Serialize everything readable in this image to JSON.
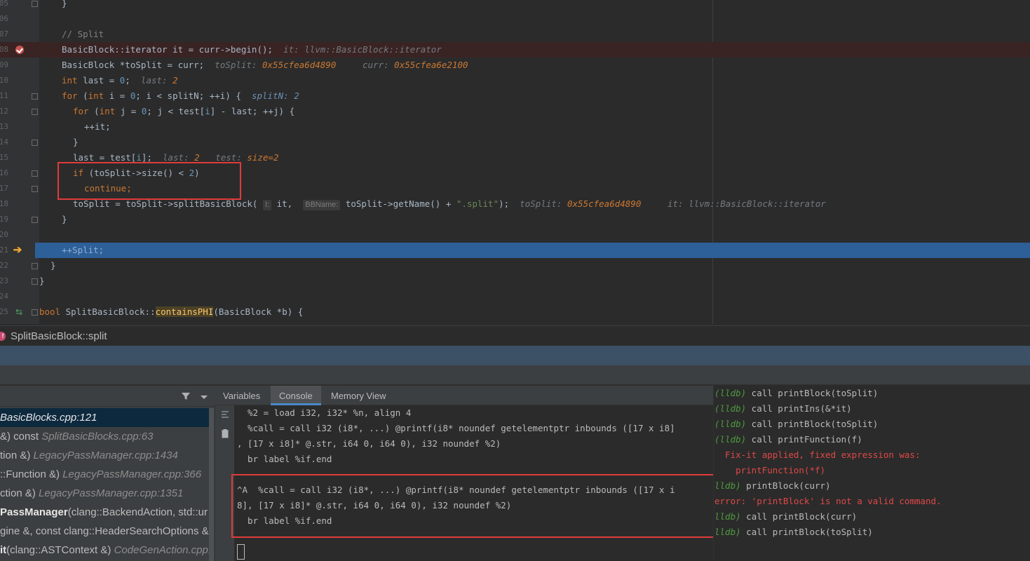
{
  "editor": {
    "lines": [
      {
        "num": "05",
        "code": "  }"
      },
      {
        "num": "06",
        "code": ""
      },
      {
        "num": "07",
        "code": "  // Split"
      },
      {
        "num": "08",
        "code": "  BasicBlock::iterator it = curr->begin();",
        "hint1_label": "it:",
        "hint1_value": "llvm::BasicBlock::iterator"
      },
      {
        "num": "09",
        "code": "  BasicBlock *toSplit = curr;",
        "hint1_label": "toSplit:",
        "hint1_value": "0x55cfea6d4890",
        "hint2_label": "curr:",
        "hint2_value": "0x55cfea6e2100"
      },
      {
        "num": "10",
        "code_kw": "int",
        "code_rest": " last = ",
        "code_num": "0",
        "code_end": ";",
        "hint1_label": "last:",
        "hint1_value": "2"
      },
      {
        "num": "11",
        "code": "  for (int i = 0; i < splitN; ++i) {",
        "hint1_label": "splitN:",
        "hint1_value": "2"
      },
      {
        "num": "12",
        "code": "    for (int j = 0; j < test[i] - last; ++j) {"
      },
      {
        "num": "13",
        "code": "      ++it;"
      },
      {
        "num": "14",
        "code": "    }"
      },
      {
        "num": "15",
        "code": "    last = test[i];",
        "hint1_label": "last:",
        "hint1_value": "2",
        "hint2_label": "test:",
        "hint2_value": "size=2"
      },
      {
        "num": "16",
        "code": "    if (toSplit->size() < 2)"
      },
      {
        "num": "17",
        "code": "      continue;"
      },
      {
        "num": "18",
        "code_a": "    toSplit = toSplit->splitBasicBlock(",
        "param1": "I:",
        "code_b": " it, ",
        "param2": "BBName:",
        "code_c": " toSplit->getName() + ",
        "code_str": "\".split\"",
        "code_d": ");",
        "hint1_label": "toSplit:",
        "hint1_value": "0x55cfea6d4890",
        "hint2_label": "it:",
        "hint2_value": "llvm::BasicBlock::iterator"
      },
      {
        "num": "19",
        "code": "  }"
      },
      {
        "num": "20",
        "code": ""
      },
      {
        "num": "21",
        "code": "  ++Split;"
      },
      {
        "num": "22",
        "code": "  }"
      },
      {
        "num": "23",
        "code": "}"
      },
      {
        "num": "24",
        "code": ""
      },
      {
        "num": "25",
        "code_kw": "bool",
        "code_rest": " SplitBasicBlock::",
        "code_fn": "containsPHI",
        "code_end": "(BasicBlock *b) {"
      }
    ]
  },
  "breadcrumb": {
    "icon_letter": "f",
    "function": "SplitBasicBlock::split"
  },
  "frames": {
    "items": [
      {
        "name": "",
        "file": "BasicBlocks.cpp:121",
        "selected": true
      },
      {
        "name": "&) const ",
        "file": "SplitBasicBlocks.cpp:63"
      },
      {
        "name": "tion &) ",
        "file": "LegacyPassManager.cpp:1434"
      },
      {
        "name": "::Function &) ",
        "file": "LegacyPassManager.cpp:366"
      },
      {
        "name": "ction &) ",
        "file": "LegacyPassManager.cpp:1351"
      },
      {
        "bold": "PassManager",
        "name": "(clang::BackendAction, std::ur",
        "file": ""
      },
      {
        "name": "gine &, const clang::HeaderSearchOptions &,",
        "file": ""
      },
      {
        "bold": "it",
        "name": "(clang::ASTContext &) ",
        "file": "CodeGenAction.cpp:"
      }
    ]
  },
  "tabs": {
    "variables": "Variables",
    "console": "Console",
    "memory": "Memory View"
  },
  "console": {
    "lines": [
      "  %2 = load i32, i32* %n, align 4",
      "  %call = call i32 (i8*, ...) @printf(i8* noundef getelementptr inbounds ([17 x i8]",
      ", [17 x i8]* @.str, i64 0, i64 0), i32 noundef %2)",
      "  br label %if.end",
      "^A  %call = call i32 (i8*, ...) @printf(i8* noundef getelementptr inbounds ([17 x i",
      "8], [17 x i8]* @.str, i64 0, i64 0), i32 noundef %2)",
      "  br label %if.end"
    ]
  },
  "lldb": {
    "lines": [
      {
        "prompt": "(lldb)",
        "text": " call printBlock(toSplit)"
      },
      {
        "prompt": "(lldb)",
        "text": " call printIns(&*it)"
      },
      {
        "prompt": "(lldb)",
        "text": " call printBlock(toSplit)"
      },
      {
        "prompt": "(lldb)",
        "text": " call printFunction(f)"
      },
      {
        "prompt": "",
        "text": "  Fix-it applied, fixed expression was:",
        "error": true
      },
      {
        "prompt": "",
        "text": "    printFunction(*f)",
        "error": true
      },
      {
        "prompt": "lldb)",
        "text": " printBlock(curr)"
      },
      {
        "prompt": "",
        "text": "error: 'printBlock' is not a valid command.",
        "error": true
      },
      {
        "prompt": "lldb)",
        "text": " call printBlock(curr)"
      },
      {
        "prompt": "lldb)",
        "text": " call printBlock(toSplit)"
      }
    ]
  },
  "colors": {
    "exec_line": "#2d5f98",
    "highlight_box": "#e03b3b",
    "keyword": "#cc7832",
    "number": "#6897bb",
    "lldb_prompt": "#4f9a3f",
    "error": "#e04848"
  }
}
